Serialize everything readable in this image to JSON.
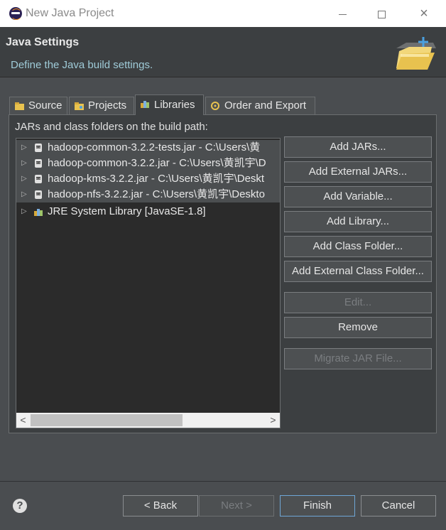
{
  "window": {
    "title": "New Java Project",
    "controls": {
      "minimize": "minimize-icon",
      "maximize": "maximize-icon",
      "close": "×"
    }
  },
  "header": {
    "title": "Java Settings",
    "description": "Define the Java build settings."
  },
  "tabs": [
    {
      "label": "Source",
      "icon": "source-icon",
      "active": false
    },
    {
      "label": "Projects",
      "icon": "projects-icon",
      "active": false
    },
    {
      "label": "Libraries",
      "icon": "libraries-icon",
      "active": true
    },
    {
      "label": "Order and Export",
      "icon": "order-export-icon",
      "active": false
    }
  ],
  "libraries": {
    "label": "JARs and class folders on the build path:",
    "entries": [
      {
        "text": "hadoop-common-3.2.2-tests.jar - C:\\Users\\黄",
        "icon": "jar-icon",
        "selected": true
      },
      {
        "text": "hadoop-common-3.2.2.jar - C:\\Users\\黄凯宇\\D",
        "icon": "jar-icon",
        "selected": true
      },
      {
        "text": "hadoop-kms-3.2.2.jar - C:\\Users\\黄凯宇\\Deskt",
        "icon": "jar-icon",
        "selected": true
      },
      {
        "text": "hadoop-nfs-3.2.2.jar - C:\\Users\\黄凯宇\\Deskto",
        "icon": "jar-icon",
        "selected": true
      },
      {
        "text": "JRE System Library [JavaSE-1.8]",
        "icon": "library-icon",
        "selected": false
      }
    ],
    "buttons": {
      "add_jars": "Add JARs...",
      "add_external_jars": "Add External JARs...",
      "add_variable": "Add Variable...",
      "add_library": "Add Library...",
      "add_class_folder": "Add Class Folder...",
      "add_external_class_folder": "Add External Class Folder...",
      "edit": "Edit...",
      "remove": "Remove",
      "migrate_jar": "Migrate JAR File..."
    }
  },
  "footer": {
    "help": "?",
    "back": "< Back",
    "next": "Next >",
    "finish": "Finish",
    "cancel": "Cancel"
  }
}
